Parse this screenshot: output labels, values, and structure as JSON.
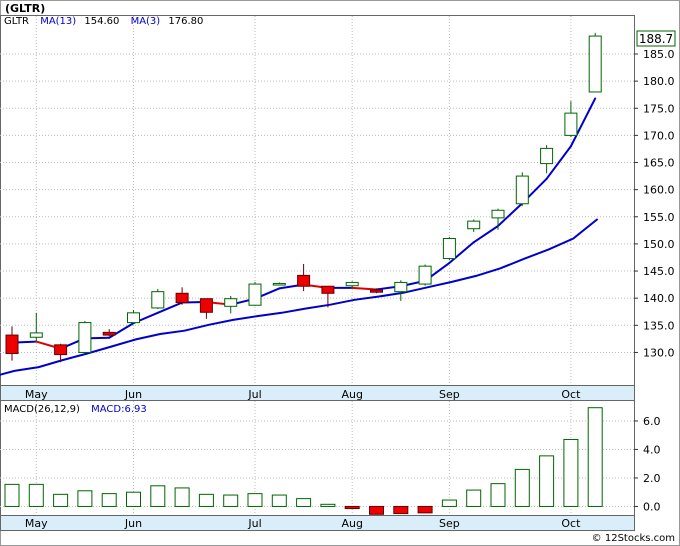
{
  "title": "(GLTR)",
  "footer": "© 12Stocks.com",
  "colors": {
    "ma_short": "#dd0000",
    "ma_long": "#0000cc",
    "up_candle_fill": "#ffffff",
    "down_candle_fill": "#ee0000",
    "candle_edge": "#006600",
    "macd_bar_pos_fill": "#ffffff",
    "macd_bar_neg_fill": "#ee0000",
    "xaxis_band": "#d9eef8",
    "last_price_fill": "#ffffff",
    "last_price_edge": "#006600"
  },
  "chart_data": [
    {
      "type": "candlestick",
      "legend": {
        "symbol": "GLTR",
        "items": [
          {
            "label": "MA(13)",
            "value": "154.60"
          },
          {
            "label": "MA(3)",
            "value": "176.80"
          }
        ]
      },
      "last_price_label": "188.7",
      "ylim": [
        124,
        192
      ],
      "yticks": [
        130,
        135,
        140,
        145,
        150,
        155,
        160,
        165,
        170,
        175,
        180,
        185
      ],
      "x_month_labels": [
        {
          "label": "May",
          "index": 1
        },
        {
          "label": "Jun",
          "index": 5
        },
        {
          "label": "Jul",
          "index": 10
        },
        {
          "label": "Aug",
          "index": 14
        },
        {
          "label": "Sep",
          "index": 18
        },
        {
          "label": "Oct",
          "index": 23
        }
      ],
      "candles": [
        {
          "o": 133.2,
          "h": 134.8,
          "l": 128.5,
          "c": 129.8
        },
        {
          "o": 132.8,
          "h": 137.3,
          "l": 132.0,
          "c": 133.6
        },
        {
          "o": 131.4,
          "h": 131.6,
          "l": 128.2,
          "c": 129.6
        },
        {
          "o": 130.0,
          "h": 135.8,
          "l": 129.9,
          "c": 135.5
        },
        {
          "o": 133.7,
          "h": 134.3,
          "l": 133.0,
          "c": 133.2
        },
        {
          "o": 135.5,
          "h": 137.8,
          "l": 135.4,
          "c": 137.3
        },
        {
          "o": 138.2,
          "h": 141.7,
          "l": 138.0,
          "c": 141.2
        },
        {
          "o": 140.9,
          "h": 142.0,
          "l": 138.8,
          "c": 139.2
        },
        {
          "o": 139.9,
          "h": 139.9,
          "l": 136.2,
          "c": 137.4
        },
        {
          "o": 138.5,
          "h": 140.4,
          "l": 137.2,
          "c": 139.9
        },
        {
          "o": 138.7,
          "h": 143.0,
          "l": 138.6,
          "c": 142.6
        },
        {
          "o": 142.6,
          "h": 142.9,
          "l": 142.4,
          "c": 142.7
        },
        {
          "o": 144.2,
          "h": 146.3,
          "l": 141.3,
          "c": 142.2
        },
        {
          "o": 142.2,
          "h": 142.2,
          "l": 138.3,
          "c": 140.9
        },
        {
          "o": 142.3,
          "h": 143.1,
          "l": 141.9,
          "c": 142.9
        },
        {
          "o": 141.5,
          "h": 141.8,
          "l": 140.9,
          "c": 141.1
        },
        {
          "o": 141.2,
          "h": 143.3,
          "l": 139.5,
          "c": 142.9
        },
        {
          "o": 142.6,
          "h": 146.2,
          "l": 142.3,
          "c": 145.9
        },
        {
          "o": 147.3,
          "h": 151.3,
          "l": 147.0,
          "c": 151.0
        },
        {
          "o": 152.8,
          "h": 154.5,
          "l": 152.2,
          "c": 154.2
        },
        {
          "o": 154.8,
          "h": 156.5,
          "l": 152.6,
          "c": 156.2
        },
        {
          "o": 157.4,
          "h": 163.2,
          "l": 157.0,
          "c": 162.5
        },
        {
          "o": 164.8,
          "h": 168.2,
          "l": 163.0,
          "c": 167.6
        },
        {
          "o": 170.0,
          "h": 176.3,
          "l": 169.7,
          "c": 174.1
        },
        {
          "o": 178.0,
          "h": 188.9,
          "l": 178.0,
          "c": 188.3
        }
      ],
      "ma_short": [
        131.8,
        132.0,
        130.7,
        132.6,
        132.7,
        135.4,
        137.3,
        139.2,
        139.3,
        138.8,
        139.9,
        141.8,
        142.5,
        141.9,
        141.9,
        141.6,
        142.2,
        143.2,
        146.5,
        150.3,
        153.3,
        157.5,
        162.0,
        168.0,
        176.8
      ],
      "ma_long": [
        125.4,
        126.6,
        127.3,
        128.6,
        129.8,
        131.1,
        132.4,
        133.4,
        134.0,
        135.1,
        136.0,
        136.7,
        137.3,
        138.1,
        138.8,
        139.7,
        140.3,
        141.0,
        142.0,
        143.0,
        144.1,
        145.5,
        147.3,
        149.0,
        151.0,
        154.6
      ]
    },
    {
      "type": "bar",
      "legend": {
        "label": "MACD(26,12,9)",
        "value_label": "MACD:6.93"
      },
      "ylim": [
        -0.6,
        7.4
      ],
      "yticks": [
        0.0,
        2.0,
        4.0,
        6.0
      ],
      "ytick_labels": [
        "0.0",
        "2.0",
        "4.0",
        "6.0"
      ],
      "values": [
        1.55,
        1.55,
        0.85,
        1.1,
        0.9,
        1.0,
        1.45,
        1.3,
        0.85,
        0.8,
        0.9,
        0.8,
        0.55,
        0.15,
        -0.15,
        -0.55,
        -0.5,
        -0.45,
        0.45,
        1.15,
        1.6,
        2.6,
        3.55,
        4.7,
        6.93
      ]
    }
  ]
}
